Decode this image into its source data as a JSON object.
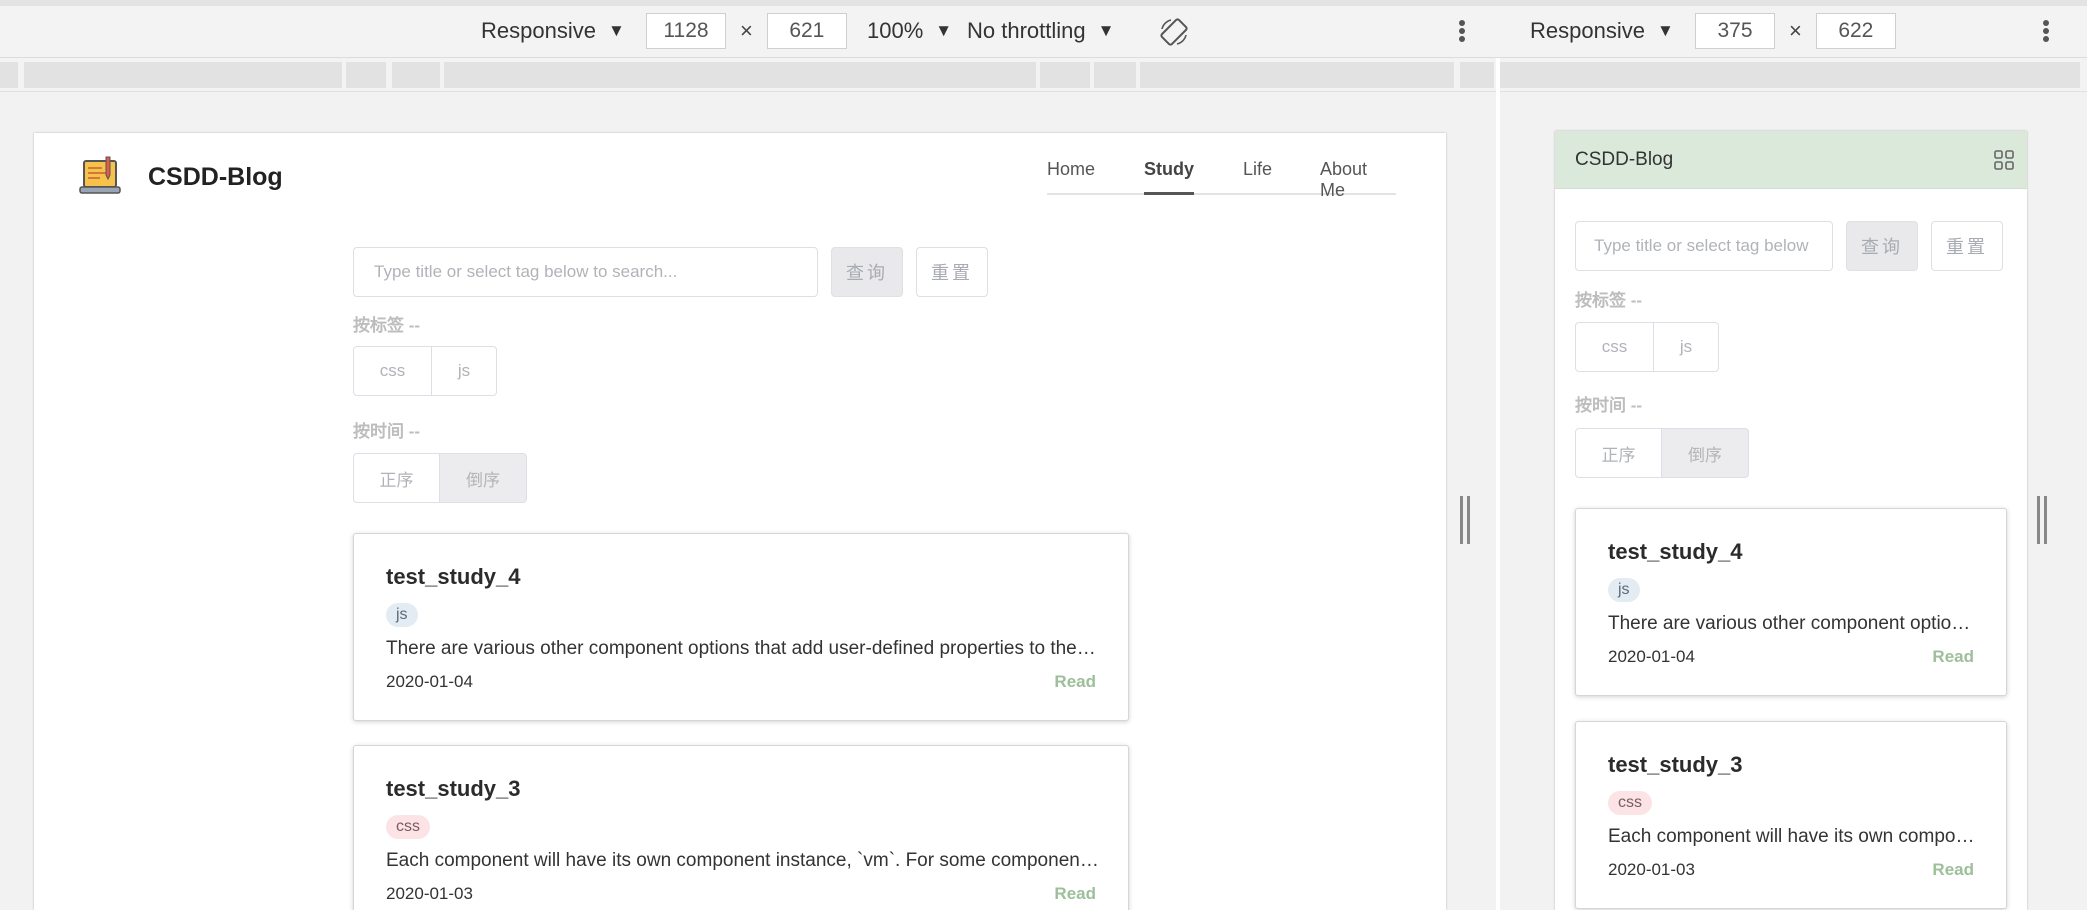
{
  "devtools": {
    "left": {
      "device": "Responsive",
      "width": "1128",
      "height": "621",
      "zoom": "100%",
      "throttling": "No throttling"
    },
    "right": {
      "device": "Responsive",
      "width": "375",
      "height": "622"
    },
    "times": "×",
    "caret": "▼"
  },
  "site": {
    "brand": "CSDD-Blog",
    "nav": [
      {
        "label": "Home"
      },
      {
        "label": "Study",
        "active": true
      },
      {
        "label": "Life"
      },
      {
        "label": "About Me"
      }
    ],
    "search": {
      "placeholder_desktop": "Type title or select tag below to search...",
      "placeholder_mobile": "Type title or select tag below",
      "query_label": "查询",
      "reset_label": "重置"
    },
    "filters": {
      "tag_label": "按标签 --",
      "tags": [
        "css",
        "js"
      ],
      "time_label": "按时间 --",
      "orders": [
        "正序",
        "倒序"
      ],
      "active_order": "倒序"
    },
    "posts": [
      {
        "title": "test_study_4",
        "tag": "js",
        "desc": "There are various other component options that add user-defined properties to the component instance",
        "date": "2020-01-04",
        "read": "Read"
      },
      {
        "title": "test_study_3",
        "tag": "css",
        "desc": "Each component will have its own component instance, `vm`. For some component options",
        "date": "2020-01-03",
        "read": "Read"
      }
    ]
  }
}
